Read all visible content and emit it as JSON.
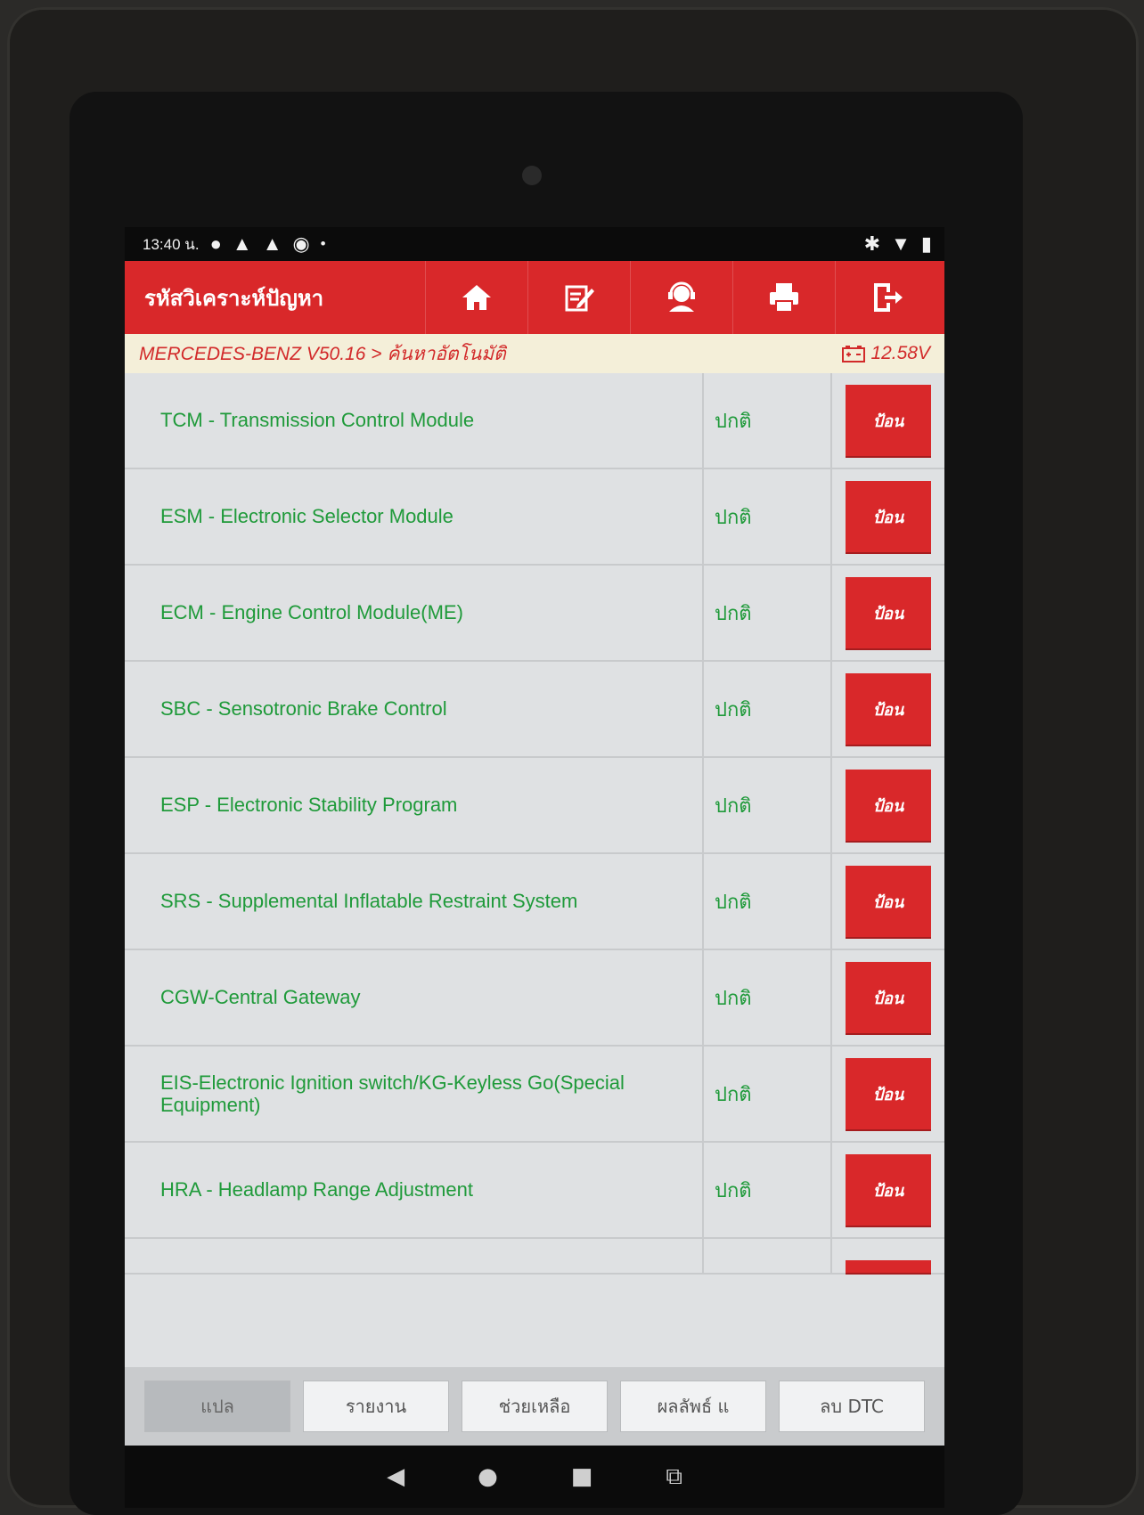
{
  "status_bar": {
    "time": "13:40 น.",
    "dot": "•"
  },
  "header": {
    "title": "รหัสวิเคราะห์ปัญหา",
    "tools": [
      "home-icon",
      "edit-report-icon",
      "support-icon",
      "print-icon",
      "exit-icon"
    ]
  },
  "breadcrumb": {
    "path": "MERCEDES-BENZ V50.16 > ค้นหาอัตโนมัติ",
    "voltage": "12.58V"
  },
  "modules": [
    {
      "name": "TCM - Transmission Control Module",
      "status": "ปกติ",
      "action": "ป้อน"
    },
    {
      "name": "ESM - Electronic Selector Module",
      "status": "ปกติ",
      "action": "ป้อน"
    },
    {
      "name": "ECM - Engine Control Module(ME)",
      "status": "ปกติ",
      "action": "ป้อน"
    },
    {
      "name": "SBC - Sensotronic Brake Control",
      "status": "ปกติ",
      "action": "ป้อน"
    },
    {
      "name": "ESP - Electronic Stability Program",
      "status": "ปกติ",
      "action": "ป้อน"
    },
    {
      "name": "SRS - Supplemental Inflatable Restraint System",
      "status": "ปกติ",
      "action": "ป้อน"
    },
    {
      "name": "CGW-Central Gateway",
      "status": "ปกติ",
      "action": "ป้อน"
    },
    {
      "name": "EIS-Electronic Ignition switch/KG-Keyless Go(Special Equipment)",
      "status": "ปกติ",
      "action": "ป้อน"
    },
    {
      "name": "HRA - Headlamp Range Adjustment",
      "status": "ปกติ",
      "action": "ป้อน"
    }
  ],
  "bottom_buttons": [
    "แปล",
    "รายงาน",
    "ช่วยเหลือ",
    "ผลลัพธ์ แ",
    "ลบ DTC"
  ],
  "colors": {
    "accent": "#d9282a",
    "ok_text": "#1f9a3a",
    "breadcrumb_bg": "#f4efd9"
  }
}
